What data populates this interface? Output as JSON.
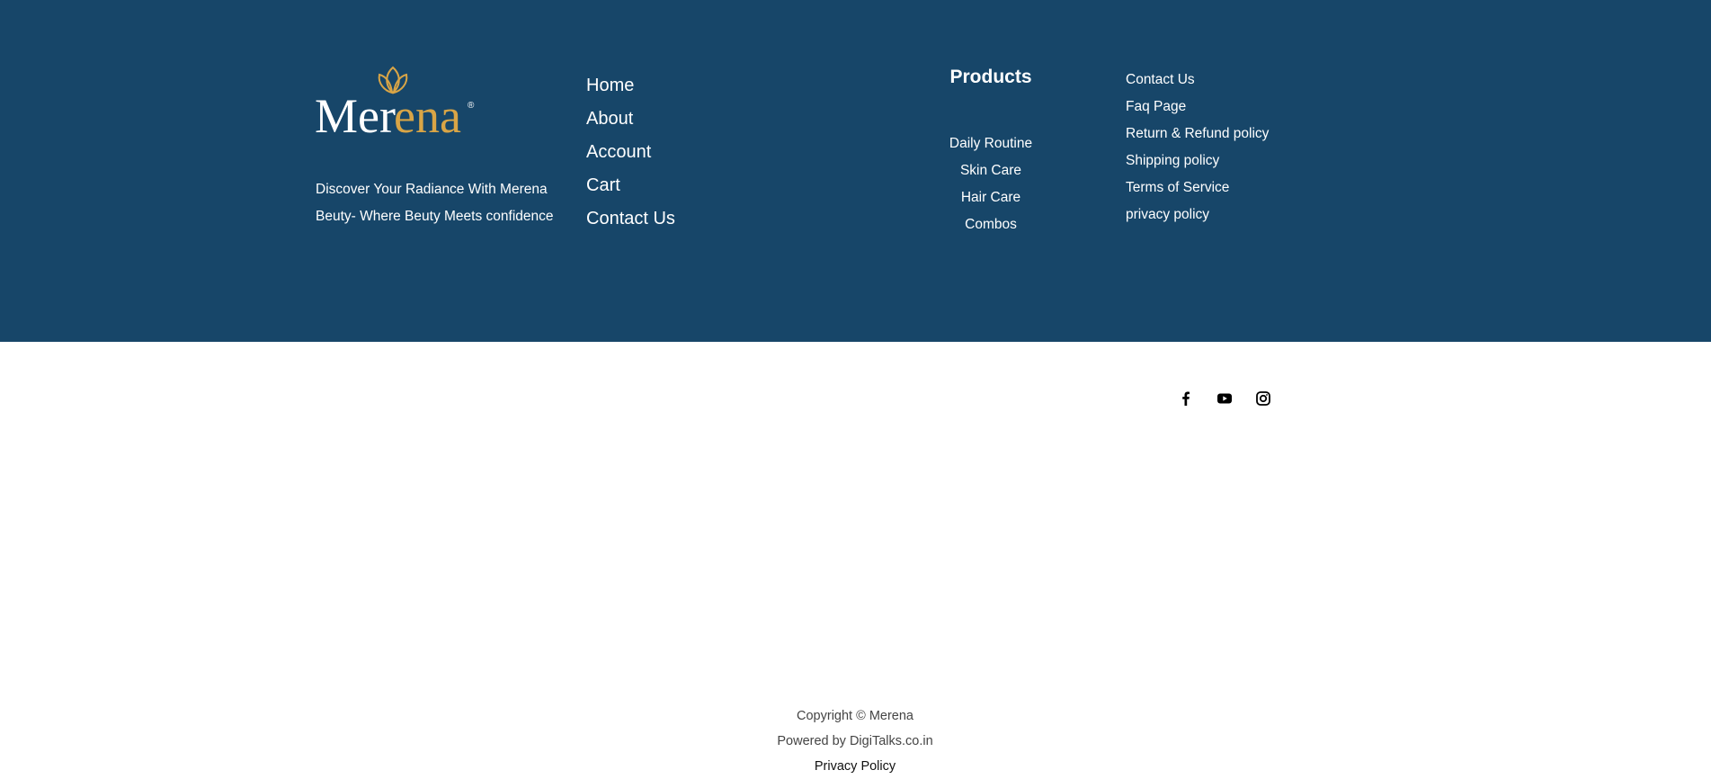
{
  "brand": {
    "logo_text_prefix": "Mer",
    "logo_text_suffix": "ena",
    "registered_mark": "®",
    "gold_color": "#d9a546",
    "background_color": "#174669"
  },
  "tagline": {
    "line1": "Discover Your Radiance With Merena",
    "line2": "Beuty- Where Beuty Meets confidence"
  },
  "nav": {
    "items": [
      {
        "label": "Home"
      },
      {
        "label": "About"
      },
      {
        "label": "Account"
      },
      {
        "label": "Cart"
      },
      {
        "label": "Contact Us"
      }
    ]
  },
  "products": {
    "title": "Products",
    "items": [
      {
        "label": "Daily Routine"
      },
      {
        "label": "Skin Care"
      },
      {
        "label": "Hair Care"
      },
      {
        "label": "Combos"
      }
    ]
  },
  "legal": {
    "items": [
      {
        "label": "Contact Us"
      },
      {
        "label": "Faq Page"
      },
      {
        "label": "Return & Refund policy"
      },
      {
        "label": "Shipping policy"
      },
      {
        "label": "Terms of Service"
      },
      {
        "label": "privacy policy"
      }
    ]
  },
  "bottom": {
    "copyright": "Copyright © Merena",
    "powered_by": "Powered by DigiTalks.co.in",
    "privacy_policy": "Privacy Policy"
  },
  "social": {
    "icons": [
      "facebook-icon",
      "youtube-icon",
      "instagram-icon"
    ]
  }
}
